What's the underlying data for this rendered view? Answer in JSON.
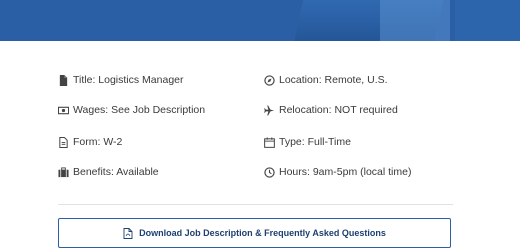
{
  "job_details": {
    "title": "Title: Logistics Manager",
    "location": "Location: Remote, U.S.",
    "wages": "Wages: See Job Description",
    "relocation": "Relocation: NOT required",
    "form": "Form: W-2",
    "type": "Type: Full-Time",
    "benefits": "Benefits: Available",
    "hours": "Hours: 9am-5pm (local time)"
  },
  "download_button": {
    "label": "Download Job Description & Frequently Asked Questions"
  },
  "icons": {
    "title": "file-icon",
    "location": "location-circle-icon",
    "wages": "money-bill-icon",
    "relocation": "plane-icon",
    "form": "document-icon",
    "type": "calendar-icon",
    "benefits": "briefcase-icon",
    "hours": "clock-icon",
    "download": "pdf-file-icon"
  },
  "colors": {
    "hero": "#2a5fa5",
    "button_border": "#2a5fa5",
    "button_text": "#1e3f70"
  }
}
